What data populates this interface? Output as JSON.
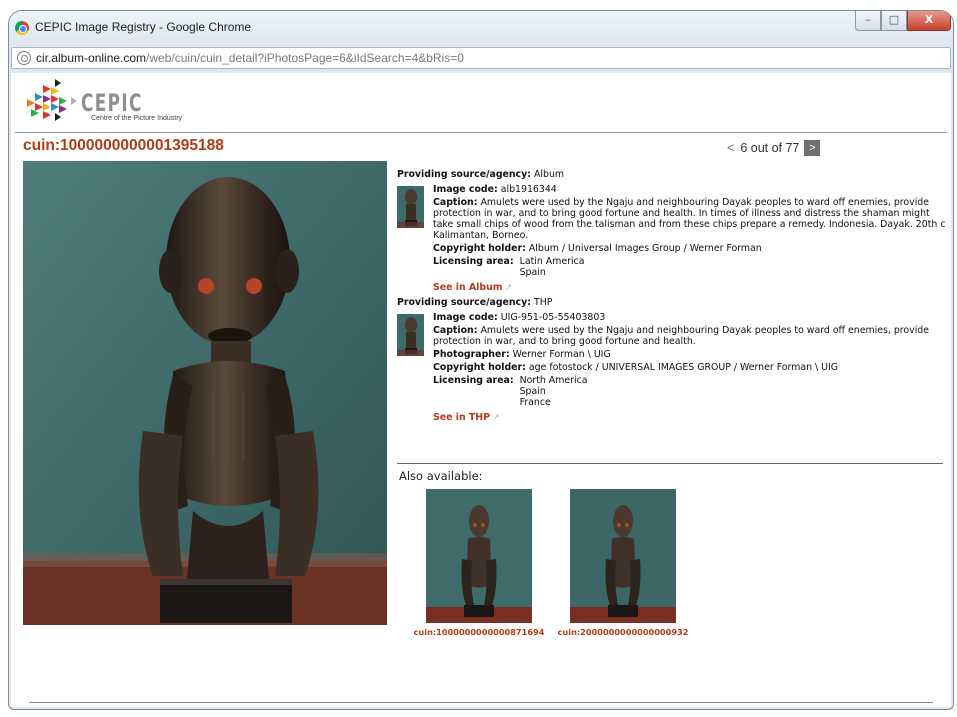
{
  "window": {
    "title": "CEPIC Image Registry - Google Chrome",
    "controls": {
      "minimize": "–",
      "maximize": "□",
      "close": "X"
    }
  },
  "url": {
    "host": "cir.album-online.com",
    "path": "/web/cuin/cuin_detail?iPhotosPage=6&iIdSearch=4&bRis=0"
  },
  "logo": {
    "word": "CEPIC",
    "subtitle": "Centre of the Picture Industry"
  },
  "cuin_title": "cuin:1000000000001395188",
  "pager": {
    "prev": "<",
    "text": "6 out of 77",
    "next": ">"
  },
  "records": [
    {
      "source_label": "Providing source/agency:",
      "source": "Album",
      "image_code_label": "Image code:",
      "image_code": "alb1916344",
      "caption_label": "Caption:",
      "caption": "Amulets were used by the Ngaju and neighbouring Dayak peoples to ward off enemies, provide protection in war, and to bring good fortune and health. In times of illness and distress the shaman might take small chips of wood from the talisman and from these chips prepare a remedy. Indonesia. Dayak. 20th c Kalimantan, Borneo.",
      "copyright_label": "Copyright holder:",
      "copyright": "Album / Universal Images Group / Werner Forman",
      "licensing_label": "Licensing area:",
      "licensing": [
        "Latin America",
        "Spain"
      ],
      "see_link": "See in Album"
    },
    {
      "source_label": "Providing source/agency:",
      "source": "THP",
      "image_code_label": "Image code:",
      "image_code": "UIG-951-05-55403803",
      "caption_label": "Caption:",
      "caption": "Amulets were used by the Ngaju and neighbouring Dayak peoples to ward off enemies, provide protection in war, and to bring good fortune and health.",
      "photographer_label": "Photographer:",
      "photographer": "Werner Forman \\ UIG",
      "copyright_label": "Copyright holder:",
      "copyright": "age fotostock / UNIVERSAL IMAGES GROUP / Werner Forman \\ UIG",
      "licensing_label": "Licensing area:",
      "licensing": [
        "North America",
        "Spain",
        "France"
      ],
      "see_link": "See in THP"
    }
  ],
  "also": {
    "label": "Also available:",
    "items": [
      {
        "caption": "cuin:1000000000000871694"
      },
      {
        "caption": "cuin:2000000000000000932"
      }
    ]
  }
}
